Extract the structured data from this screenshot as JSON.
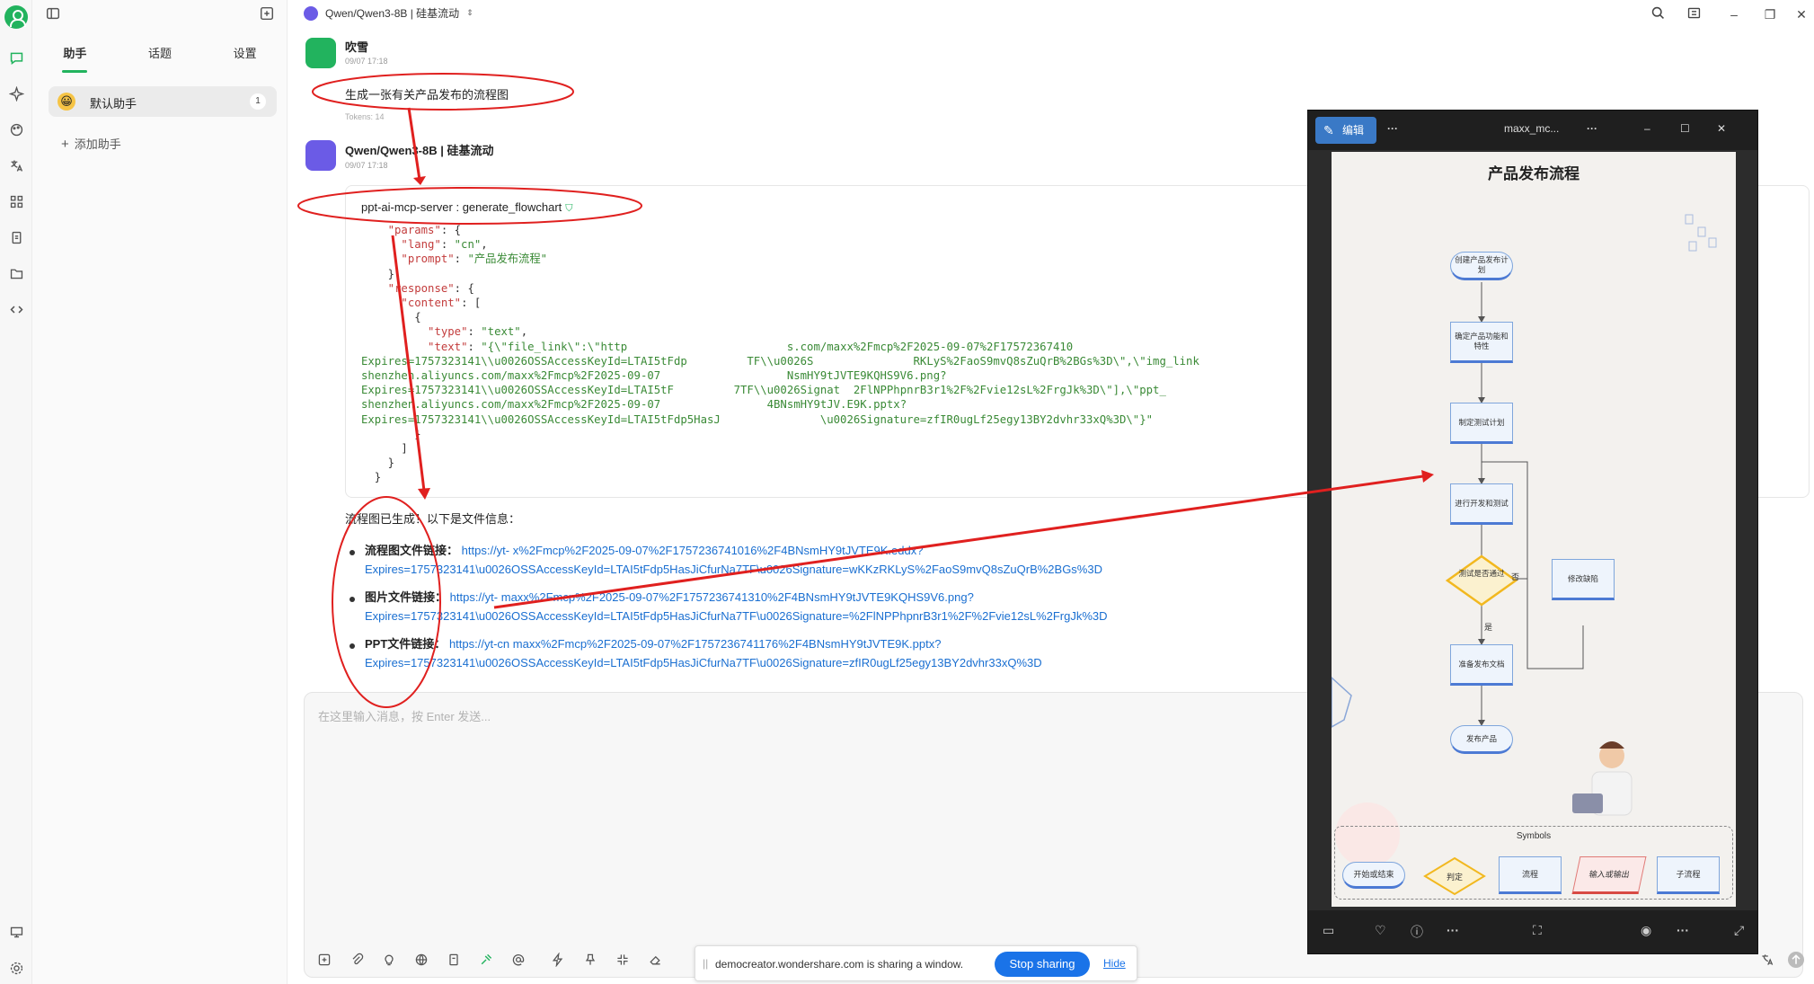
{
  "top": {
    "model_title": "Qwen/Qwen3-8B | 硅基流动",
    "model_chevron": "⌃⌄"
  },
  "sidebar": {
    "tabs": [
      "助手",
      "话题",
      "设置"
    ],
    "assistant": {
      "emoji": "😀",
      "name": "默认助手",
      "count": "1"
    },
    "add_label": "添加助手"
  },
  "chat": {
    "user": {
      "name": "吹雪",
      "time": "09/07 17:18",
      "message": "生成一张有关产品发布的流程图",
      "tokens": "Tokens: 14"
    },
    "bot": {
      "name": "Qwen/Qwen3-8B | 硅基流动",
      "time": "09/07 17:18"
    },
    "tool": {
      "header": "ppt-ai-mcp-server : generate_flowchart",
      "code": {
        "l1_key": "\"params\"",
        "l2_key": "\"lang\"",
        "l2_val": "\"cn\"",
        "l3_key": "\"prompt\"",
        "l3_val": "\"产品发布流程\"",
        "l5_key": "\"response\"",
        "l6_key": "\"content\"",
        "l8_key": "\"type\"",
        "l8_val": "\"text\"",
        "l9_key": "\"text\"",
        "l9_val": "\"{\\\"file_link\\\":\\\"http",
        "l9_tail": "s.com/maxx%2Fmcp%2F2025-09-07%2F17572367410",
        "l10": "Expires=1757323141\\\\u0026OSSAccessKeyId=LTAI5tFdp",
        "l10_tail": "TF\\\\u0026S",
        "l10_tail2": "RKLyS%2FaoS9mvQ8sZuQrB%2BGs%3D\\\",\\\"img_link",
        "l11": "shenzhen.aliyuncs.com/maxx%2Fmcp%2F2025-09-07",
        "l11_tail": "NsmHY9tJVTE9KQHS9V6.png?",
        "l12": "Expires=1757323141\\\\u0026OSSAccessKeyId=LTAI5tF",
        "l12_tail": "7TF\\\\u0026Signat",
        "l12_tail2": "2FlNPPhpnrB3r1%2F%2Fvie12sL%2FrgJk%3D\\\"],\\\"ppt_",
        "l13": "shenzhen.aliyuncs.com/maxx%2Fmcp%2F2025-09-07",
        "l13_tail": "4BNsmHY9tJV.E9K.pptx?",
        "l14": "Expires=1757323141\\\\u0026OSSAccessKeyId=LTAI5tFdp5HasJ",
        "l14_tail": "\\u0026Signature=zfIR0ugLf25egy13BY2dvhr33xQ%3D\\\"}\""
      }
    },
    "result_heading": "流程图已生成！以下是文件信息：",
    "links": [
      {
        "label": "流程图文件链接",
        "line1_a": "https://yt-",
        "line1_b": "x%2Fmcp%2F2025-09-07%2F1757236741016%2F4BNsmHY9tJVTE9K.eddx?",
        "line2": "Expires=1757323141\\u0026OSSAccessKeyId=LTAI5tFdp5HasJiCfurNa7TF\\u0026Signature=wKKzRKLyS%2FaoS9mvQ8sZuQrB%2BGs%3D"
      },
      {
        "label": "图片文件链接",
        "line1_a": "https://yt-",
        "line1_b": "maxx%2Fmcp%2F2025-09-07%2F1757236741310%2F4BNsmHY9tJVTE9KQHS9V6.png?",
        "line2": "Expires=1757323141\\u0026OSSAccessKeyId=LTAI5tFdp5HasJiCfurNa7TF\\u0026Signature=%2FlNPPhpnrB3r1%2F%2Fvie12sL%2FrgJk%3D"
      },
      {
        "label": "PPT文件链接",
        "line1_a": "https://yt-cn",
        "line1_b": "maxx%2Fmcp%2F2025-09-07%2F1757236741176%2F4BNsmHY9tJVTE9K.pptx?",
        "line2": "Expires=1757323141\\u0026OSSAccessKeyId=LTAI5tFdp5HasJiCfurNa7TF\\u0026Signature=zfIR0ugLf25egy13BY2dvhr33xQ%3D"
      }
    ]
  },
  "composer": {
    "placeholder": "在这里输入消息，按 Enter 发送..."
  },
  "share_banner": {
    "grip": "||",
    "text": "democreator.wondershare.com is sharing a window.",
    "stop": "Stop sharing",
    "hide": "Hide"
  },
  "viewer": {
    "edit_label": "编辑",
    "title": "maxx_mc...",
    "ellipsis": "···",
    "flowchart": {
      "title": "产品发布流程",
      "nodes": {
        "start": "创建产品发布计划",
        "n2": "确定产品功能和特性",
        "n3": "制定测试计划",
        "n4": "进行开发和测试",
        "decision": "测试是否通过",
        "fix": "修改缺陷",
        "n6": "准备发布文档",
        "end": "发布产品"
      },
      "no_label": "否",
      "yes_label": "是",
      "symbols_title": "Symbols",
      "symbols": [
        "开始或结束",
        "判定",
        "流程",
        "输入或输出",
        "子流程"
      ]
    }
  },
  "colors": {
    "accent": "#22b35e",
    "link": "#1a6fd1",
    "annotation": "#e0201f"
  }
}
